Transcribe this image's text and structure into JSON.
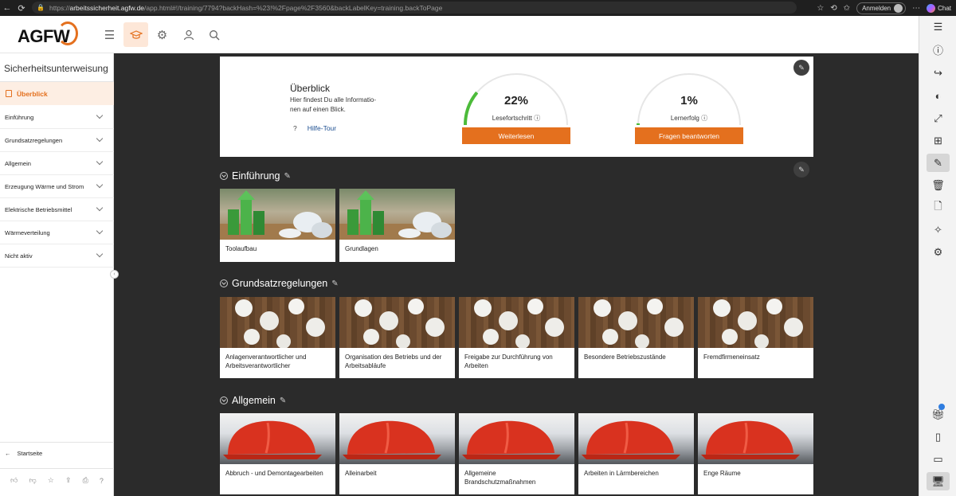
{
  "browser": {
    "url_prefix": "https://",
    "url_host": "arbeitssicherheit.agfw.de",
    "url_path": "/app.html#!/training/7794?backHash=%23!%2Fpage%2F3560&backLabelKey=training.backToPage",
    "signin_label": "Anmelden",
    "chat_label": "Chat"
  },
  "header": {
    "logo_text": "AGFW"
  },
  "sidebar": {
    "title": "Sicherheitsunterweisung",
    "overview_label": "Überblick",
    "items": [
      {
        "label": "Einführung"
      },
      {
        "label": "Grundsatzregelungen"
      },
      {
        "label": "Allgemein"
      },
      {
        "label": "Erzeugung Wärme und Strom"
      },
      {
        "label": "Elektrische Betriebsmittel"
      },
      {
        "label": "Wärmeverteilung"
      },
      {
        "label": "Nicht aktiv"
      }
    ],
    "home_label": "Startseite"
  },
  "overview": {
    "title": "Überblick",
    "description": "Hier findest Du alle Informatio-\nnen auf einen Blick.",
    "help_label": "Hilfe-Tour",
    "reading": {
      "value_text": "22%",
      "fraction": 0.22,
      "label": "Lesefortschritt",
      "button": "Weiterlesen"
    },
    "learning": {
      "value_text": "1%",
      "fraction": 0.01,
      "label": "Lernerfolg",
      "button": "Fragen beantworten"
    }
  },
  "sections": [
    {
      "title": "Einführung",
      "tiles": [
        {
          "label": "Toolaufbau"
        },
        {
          "label": "Grundlagen"
        }
      ]
    },
    {
      "title": "Grundsatzregelungen",
      "tiles": [
        {
          "label": "Anlagenverantwortlicher und Arbeitsverantwortlicher"
        },
        {
          "label": "Organisation des Betriebs und der Arbeitsabläufe"
        },
        {
          "label": "Freigabe zur Durchführung von Arbeiten"
        },
        {
          "label": "Besondere Betriebszustände"
        },
        {
          "label": "Fremdfirmeneinsatz"
        }
      ]
    },
    {
      "title": "Allgemein",
      "tiles": [
        {
          "label": "Abbruch - und Demontagearbeiten"
        },
        {
          "label": "Alleinarbeit"
        },
        {
          "label": "Allgemeine Brandschutzmaßnahmen"
        },
        {
          "label": "Arbeiten in Lärmbereichen"
        },
        {
          "label": "Enge Räume"
        }
      ]
    }
  ],
  "colors": {
    "accent": "#E4701E",
    "progress_green": "#4CBB3A",
    "link": "#1D4F91"
  }
}
